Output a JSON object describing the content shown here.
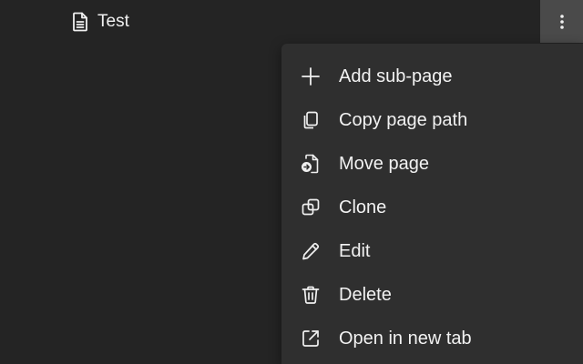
{
  "page_row": {
    "icon": "document-icon",
    "label": "Test"
  },
  "more_button": {
    "icon": "vertical-ellipsis-icon"
  },
  "menu": {
    "items": [
      {
        "label": "Add sub-page",
        "icon": "plus-icon"
      },
      {
        "label": "Copy page path",
        "icon": "copy-icon"
      },
      {
        "label": "Move page",
        "icon": "move-document-icon"
      },
      {
        "label": "Clone",
        "icon": "clone-icon"
      },
      {
        "label": "Edit",
        "icon": "pencil-icon"
      },
      {
        "label": "Delete",
        "icon": "trash-icon"
      },
      {
        "label": "Open in new tab",
        "icon": "open-external-icon"
      }
    ]
  },
  "colors": {
    "background": "#242424",
    "menu_background": "#2f2f2f",
    "more_button_background": "#4a4a4a",
    "text": "#f2f2f2"
  }
}
